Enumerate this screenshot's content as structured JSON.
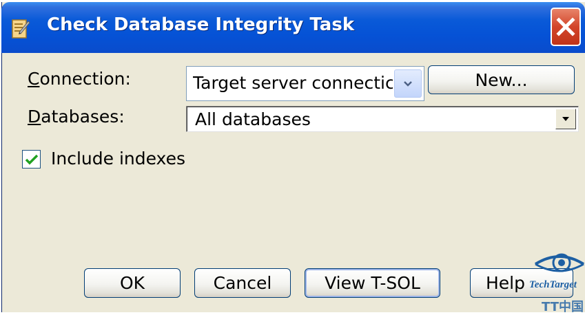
{
  "window": {
    "title": "Check Database Integrity Task"
  },
  "form": {
    "connection_label": "Connection:",
    "connection_value": "Target server connectic",
    "new_button": "New...",
    "databases_label": "Databases:",
    "databases_value": "All databases",
    "include_indexes_label": "Include indexes",
    "include_indexes_checked": true
  },
  "buttons": {
    "ok": "OK",
    "cancel": "Cancel",
    "view_tsql": "View T-SOL",
    "help": "Help"
  },
  "watermark": {
    "text": "TechTarget",
    "subtext": "TT中国"
  },
  "colors": {
    "title_bar": "#0552d6",
    "dialog_bg": "#ece9d8",
    "close": "#d2452a",
    "checkmark": "#21a121",
    "watermark": "#1d5fa3"
  },
  "icons": [
    "task-icon",
    "close-icon",
    "dropdown-arrow-icon",
    "checkbox-check-icon",
    "eye-logo-icon"
  ]
}
